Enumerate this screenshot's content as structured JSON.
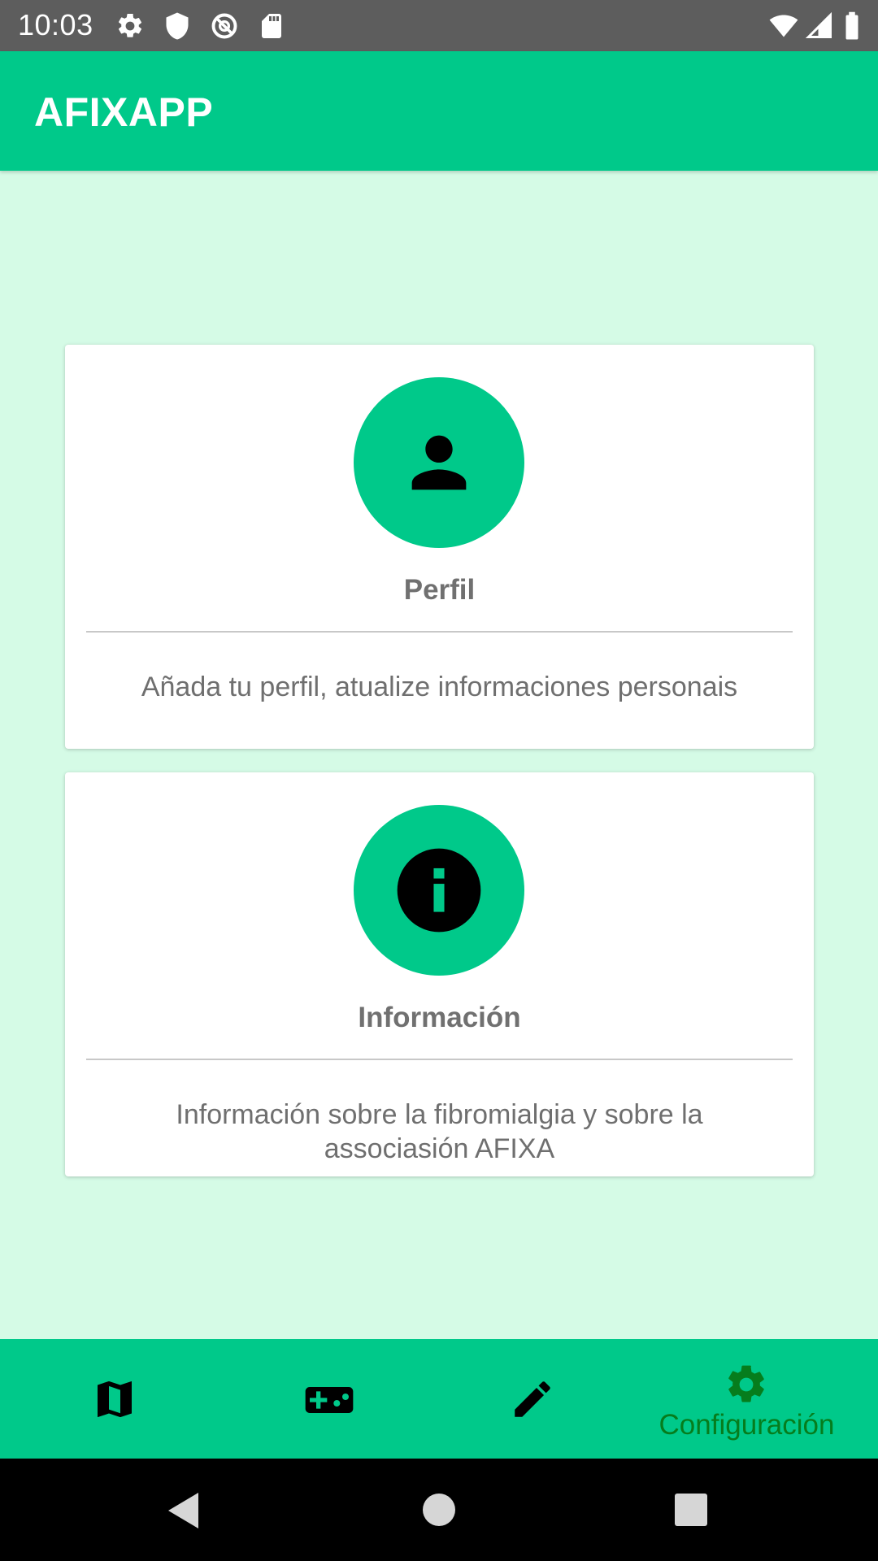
{
  "status_bar": {
    "time": "10:03",
    "left_icons": [
      "gear-icon",
      "shield-icon",
      "data-saver-icon",
      "sd-card-icon"
    ],
    "right_icons": [
      "wifi-icon",
      "cell-signal-icon",
      "battery-icon"
    ]
  },
  "app_bar": {
    "title": "AFIXAPP"
  },
  "cards": [
    {
      "icon": "person-icon",
      "title": "Perfil",
      "description": "Añada tu perfil, atualize informaciones personais"
    },
    {
      "icon": "info-icon",
      "title": "Información",
      "description": "Información sobre la fibromialgia y sobre la associasión AFIXA"
    }
  ],
  "bottom_nav": {
    "items": [
      {
        "icon": "map-icon",
        "label": ""
      },
      {
        "icon": "gamepad-icon",
        "label": ""
      },
      {
        "icon": "pencil-icon",
        "label": ""
      },
      {
        "icon": "gear-icon",
        "label": "Configuración",
        "selected": true
      }
    ]
  },
  "system_nav": {
    "buttons": [
      "back-icon",
      "home-icon",
      "recents-icon"
    ]
  },
  "colors": {
    "accent": "#00c98a",
    "background": "#d5fbe6",
    "selected_nav": "#067d1d",
    "status_bar": "#5d5d5d"
  }
}
